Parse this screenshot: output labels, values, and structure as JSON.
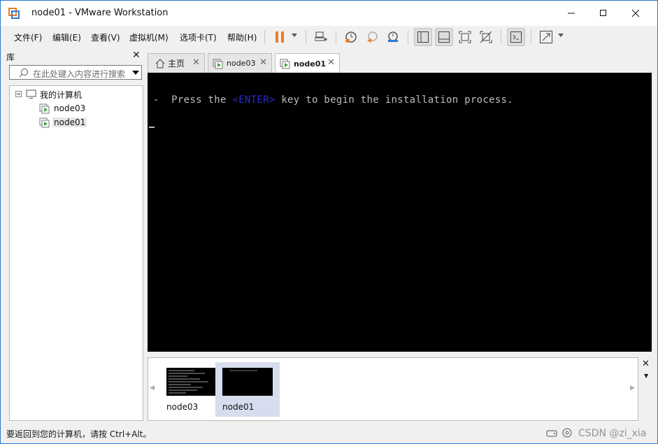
{
  "window": {
    "title": "node01 - VMware Workstation"
  },
  "menu": [
    "文件(F)",
    "编辑(E)",
    "查看(V)",
    "虚拟机(M)",
    "选项卡(T)",
    "帮助(H)"
  ],
  "library": {
    "header": "库",
    "search_placeholder": "在此处键入内容进行搜索",
    "root": "我的计算机",
    "vms": [
      "node03",
      "node01"
    ]
  },
  "tabs": [
    {
      "label": "主页",
      "active": false
    },
    {
      "label": "node03",
      "active": false
    },
    {
      "label": "node01",
      "active": true
    }
  ],
  "console": {
    "prefix": "-  Press the ",
    "key": "<ENTER>",
    "suffix": " key to begin the installation process."
  },
  "thumbnails": [
    {
      "label": "node03",
      "selected": false
    },
    {
      "label": "node01",
      "selected": true
    }
  ],
  "status": {
    "message": "要返回到您的计算机，请按 Ctrl+Alt。",
    "watermark": "CSDN @zi_xia"
  },
  "colors": {
    "accent": "#2b78d4",
    "pause": "#f07b22",
    "vm_green": "#3aa53a"
  }
}
